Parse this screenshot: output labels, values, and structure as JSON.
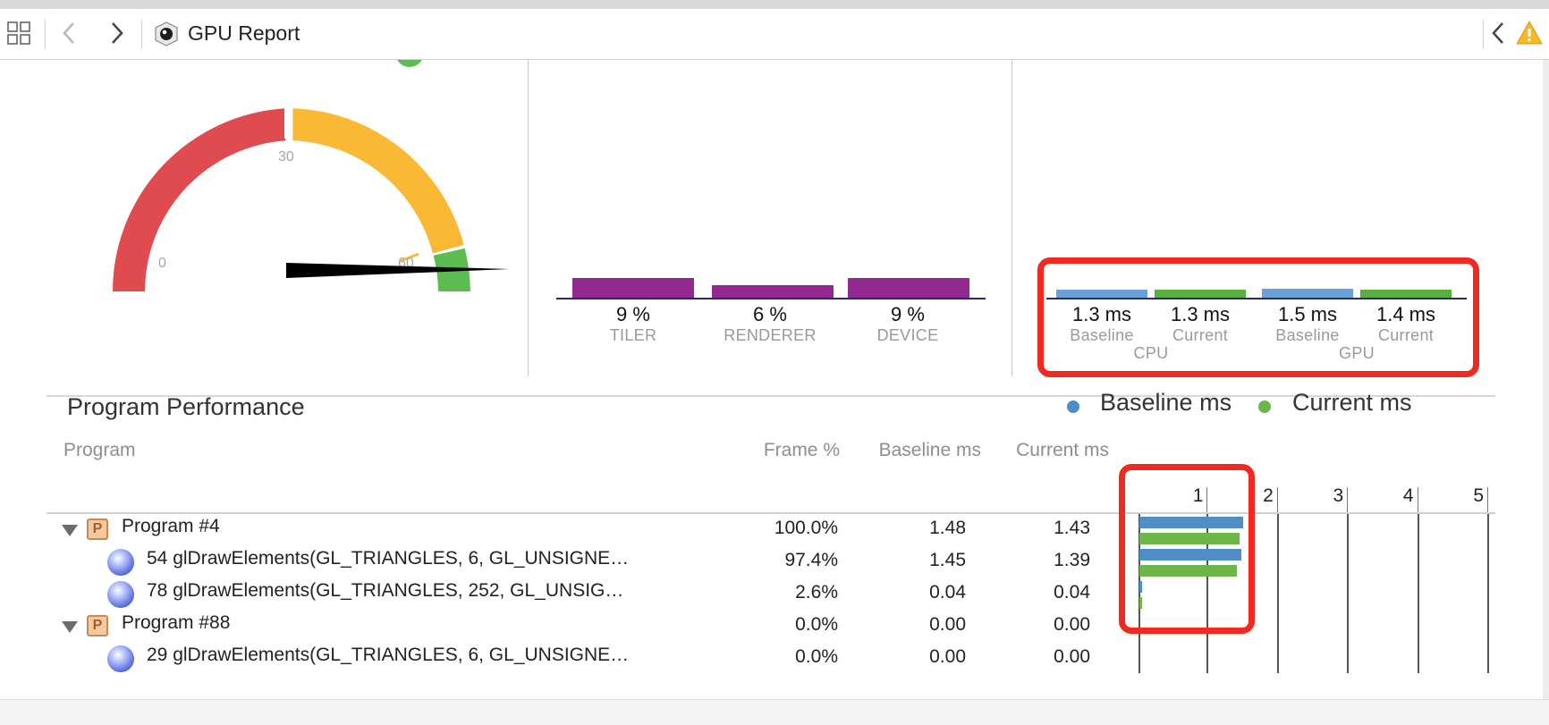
{
  "toolbar": {
    "title": "GPU Report",
    "icons": [
      "grid-icon",
      "back-chevron-icon",
      "forward-chevron-icon",
      "gpu-report-icon",
      "collapse-chevron-icon",
      "warning-icon"
    ]
  },
  "gauge": {
    "tick_0": "0",
    "tick_30": "30",
    "tick_60": "60",
    "value_fps": 60,
    "colors": {
      "low": "#e04b4f",
      "mid": "#fab934",
      "high": "#5bbd4f"
    }
  },
  "utilization": {
    "items": [
      {
        "value": "9 %",
        "label": "TILER",
        "percent": 9
      },
      {
        "value": "6 %",
        "label": "RENDERER",
        "percent": 6
      },
      {
        "value": "9 %",
        "label": "DEVICE",
        "percent": 9
      }
    ],
    "bar_color": "#93288f"
  },
  "frame_time": {
    "items": [
      {
        "value": "1.3 ms",
        "label": "Baseline",
        "ms": 1.3,
        "color": "#6a9fd8"
      },
      {
        "value": "1.3 ms",
        "label": "Current",
        "ms": 1.3,
        "color": "#5aad3f"
      },
      {
        "value": "1.5 ms",
        "label": "Baseline",
        "ms": 1.5,
        "color": "#6a9fd8"
      },
      {
        "value": "1.4 ms",
        "label": "Current",
        "ms": 1.4,
        "color": "#5aad3f"
      }
    ],
    "group_labels": [
      "CPU",
      "GPU"
    ]
  },
  "program_performance": {
    "title": "Program Performance",
    "legend": {
      "baseline": "Baseline ms",
      "current": "Current ms",
      "baseline_color": "#4e8ec6",
      "current_color": "#6cb64a"
    },
    "columns": {
      "program": "Program",
      "frame": "Frame %",
      "baseline": "Baseline ms",
      "current": "Current ms"
    },
    "axis_ticks": [
      "1",
      "2",
      "3",
      "4",
      "5"
    ],
    "rows": [
      {
        "kind": "program",
        "name": "Program #4",
        "frame": "100.0%",
        "baseline": "1.48",
        "current": "1.43",
        "baseline_ms": 1.48,
        "current_ms": 1.43
      },
      {
        "kind": "call",
        "name": "54 glDrawElements(GL_TRIANGLES, 6, GL_UNSIGNE…",
        "frame": "97.4%",
        "baseline": "1.45",
        "current": "1.39",
        "baseline_ms": 1.45,
        "current_ms": 1.39
      },
      {
        "kind": "call",
        "name": "78 glDrawElements(GL_TRIANGLES, 252, GL_UNSIG…",
        "frame": "2.6%",
        "baseline": "0.04",
        "current": "0.04",
        "baseline_ms": 0.04,
        "current_ms": 0.04
      },
      {
        "kind": "program",
        "name": "Program #88",
        "frame": "0.0%",
        "baseline": "0.00",
        "current": "0.00",
        "baseline_ms": 0.0,
        "current_ms": 0.0
      },
      {
        "kind": "call",
        "name": "29 glDrawElements(GL_TRIANGLES, 6, GL_UNSIGNE…",
        "frame": "0.0%",
        "baseline": "0.00",
        "current": "0.00",
        "baseline_ms": 0.0,
        "current_ms": 0.0
      }
    ]
  }
}
